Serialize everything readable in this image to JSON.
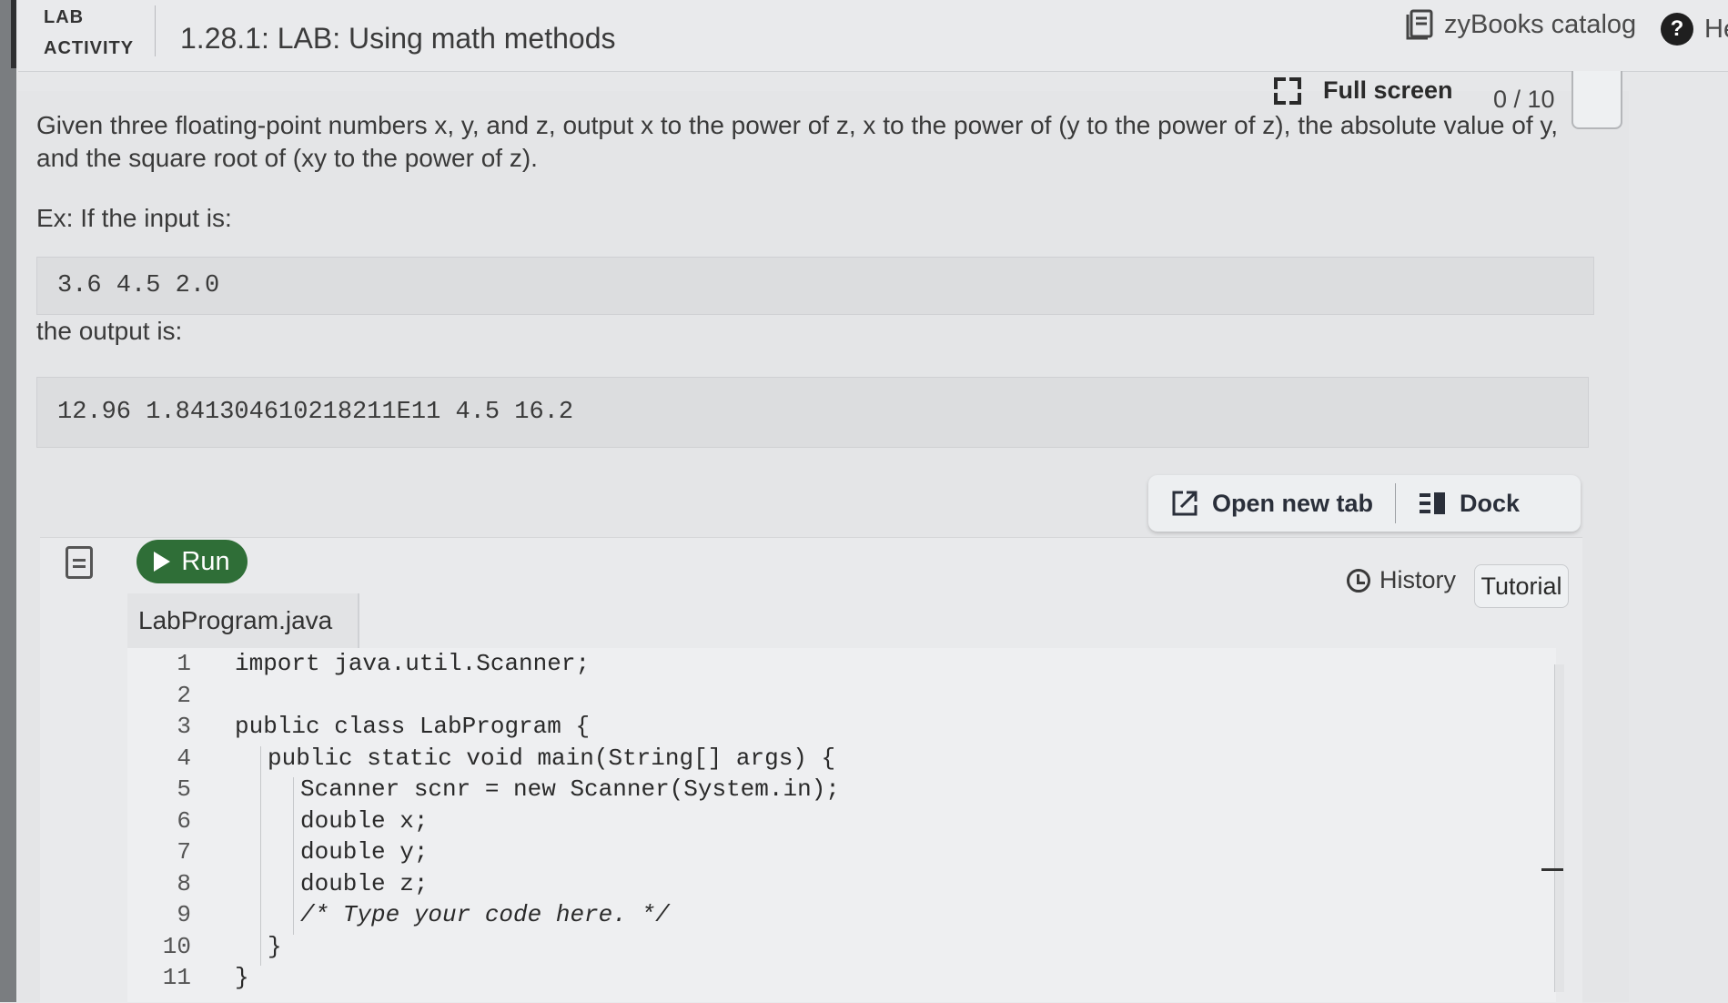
{
  "header": {
    "lab_line1": "LAB",
    "lab_line2": "ACTIVITY",
    "activity_title": "1.28.1: LAB: Using math methods",
    "catalog_label": "zyBooks catalog",
    "help_label": "Help",
    "fullscreen_label": "Full screen",
    "score": "0 / 10"
  },
  "problem": {
    "description": "Given three floating-point numbers x, y, and z, output x to the power of z, x to the power of (y to the power of z), the absolute value of y, and the square root of (xy to the power of z).",
    "example_label": "Ex: If the input is:",
    "example_input": "3.6 4.5 2.0",
    "output_label": "the output is:",
    "example_output": "12.96 1.841304610218211E11 4.5 16.2"
  },
  "toolbar": {
    "open_new_tab": "Open new tab",
    "dock": "Dock",
    "run": "Run",
    "history": "History",
    "tutorial": "Tutorial"
  },
  "editor": {
    "filename": "LabProgram.java",
    "lines": [
      {
        "n": "1",
        "code": "import java.util.Scanner;",
        "indent": 0
      },
      {
        "n": "2",
        "code": "",
        "indent": 0
      },
      {
        "n": "3",
        "code": "public class LabProgram {",
        "indent": 0
      },
      {
        "n": "4",
        "code": "public static void main(String[] args) {",
        "indent": 1
      },
      {
        "n": "5",
        "code": "Scanner scnr = new Scanner(System.in);",
        "indent": 2
      },
      {
        "n": "6",
        "code": "double x;",
        "indent": 2
      },
      {
        "n": "7",
        "code": "double y;",
        "indent": 2
      },
      {
        "n": "8",
        "code": "double z;",
        "indent": 2
      },
      {
        "n": "9",
        "code": "/* Type your code here. */",
        "indent": 2
      },
      {
        "n": "10",
        "code": "}",
        "indent": 1
      },
      {
        "n": "11",
        "code": "}",
        "indent": 0
      }
    ]
  },
  "colors": {
    "run_button": "#2f6e37",
    "background": "#e6e7e9"
  },
  "icons": {
    "catalog": "book-icon",
    "help": "question-circle-icon",
    "fullscreen": "expand-icon",
    "open_new_tab": "external-link-icon",
    "dock": "dock-icon",
    "file": "document-icon",
    "run": "play-icon",
    "history": "history-clock-icon"
  }
}
